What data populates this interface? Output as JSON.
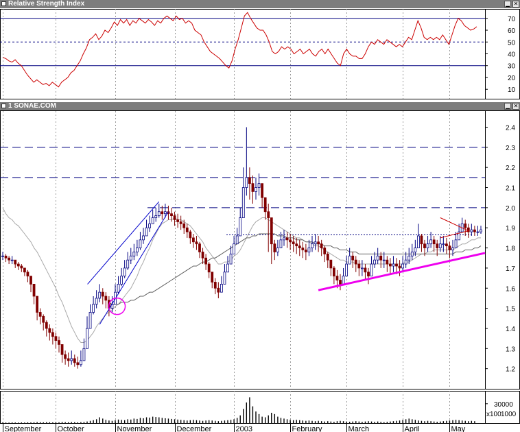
{
  "panels": {
    "rsi_title": "Relative Strength Index",
    "price_title": "1 SONAE.COM"
  },
  "colors": {
    "up": "#ffffff",
    "down": "#800000",
    "upline": "#000080",
    "rsi": "#cc0000",
    "trend_blue": "#0000cc",
    "support": "#ee00ee",
    "pennant": "#cc0000",
    "ma_fast": "#a8a8a8",
    "ma_slow": "#606060"
  },
  "chart_data": [
    {
      "type": "line",
      "title": "Relative Strength Index",
      "ylim": [
        2,
        78
      ],
      "y_ticks": [
        "10",
        "20",
        "30",
        "40",
        "50",
        "60",
        "70"
      ],
      "reference_lines": [
        30,
        50,
        70
      ],
      "series": [
        {
          "values": [
            37,
            36,
            34,
            33,
            35,
            32,
            30,
            26,
            22,
            19,
            16,
            18,
            16,
            14,
            15,
            13,
            16,
            14,
            12,
            16,
            18,
            20,
            24,
            26,
            30,
            34,
            40,
            45,
            52,
            54,
            57,
            52,
            55,
            60,
            58,
            62,
            67,
            64,
            69,
            66,
            69,
            64,
            68,
            66,
            70,
            68,
            66,
            69,
            67,
            64,
            68,
            66,
            70,
            72,
            70,
            68,
            72,
            69,
            70,
            66,
            68,
            66,
            60,
            58,
            56,
            50,
            46,
            42,
            40,
            38,
            36,
            33,
            30,
            28,
            34,
            44,
            52,
            62,
            72,
            75,
            70,
            66,
            62,
            60,
            60,
            56,
            50,
            42,
            40,
            42,
            46,
            44,
            46,
            44,
            40,
            42,
            44,
            40,
            42,
            44,
            40,
            38,
            42,
            44,
            40,
            44,
            40,
            36,
            32,
            30,
            40,
            44,
            40,
            38,
            38,
            36,
            36,
            40,
            46,
            50,
            48,
            52,
            50,
            48,
            52,
            50,
            48,
            46,
            48,
            46,
            50,
            54,
            52,
            60,
            68,
            62,
            54,
            52,
            54,
            52,
            54,
            52,
            56,
            52,
            48,
            56,
            64,
            70,
            68,
            64,
            62,
            60,
            61,
            63
          ]
        }
      ]
    },
    {
      "type": "candlestick",
      "title": "1 SONAE.COM",
      "ylim": [
        1.1,
        2.48
      ],
      "y_ticks": [
        "1.2",
        "1.3",
        "1.4",
        "1.5",
        "1.6",
        "1.7",
        "1.8",
        "1.9",
        "2.0",
        "2.1",
        "2.2",
        "2.3",
        "2.4"
      ],
      "x_labels": [
        "September",
        "October",
        "November",
        "December",
        "2003",
        "February",
        "March",
        "April",
        "May"
      ],
      "resistance_levels": [
        2.3,
        2.15,
        2.0,
        1.865
      ],
      "close": [
        1.76,
        1.75,
        1.74,
        1.74,
        1.72,
        1.71,
        1.7,
        1.68,
        1.66,
        1.62,
        1.56,
        1.48,
        1.46,
        1.43,
        1.4,
        1.38,
        1.36,
        1.34,
        1.32,
        1.27,
        1.25,
        1.24,
        1.25,
        1.23,
        1.22,
        1.24,
        1.3,
        1.4,
        1.48,
        1.52,
        1.55,
        1.58,
        1.56,
        1.54,
        1.5,
        1.52,
        1.58,
        1.62,
        1.66,
        1.7,
        1.74,
        1.76,
        1.78,
        1.8,
        1.84,
        1.86,
        1.9,
        1.92,
        1.95,
        1.96,
        1.98,
        1.97,
        1.98,
        1.97,
        1.96,
        1.94,
        1.93,
        1.92,
        1.9,
        1.88,
        1.85,
        1.83,
        1.82,
        1.78,
        1.75,
        1.72,
        1.68,
        1.63,
        1.6,
        1.58,
        1.62,
        1.68,
        1.72,
        1.77,
        1.82,
        1.86,
        1.95,
        2.1,
        2.15,
        2.12,
        2.08,
        2.1,
        2.12,
        2.05,
        1.98,
        1.95,
        1.82,
        1.78,
        1.8,
        1.84,
        1.85,
        1.84,
        1.83,
        1.82,
        1.81,
        1.8,
        1.79,
        1.78,
        1.8,
        1.82,
        1.83,
        1.82,
        1.8,
        1.77,
        1.74,
        1.7,
        1.66,
        1.64,
        1.62,
        1.66,
        1.72,
        1.76,
        1.74,
        1.72,
        1.7,
        1.7,
        1.68,
        1.66,
        1.72,
        1.74,
        1.76,
        1.74,
        1.74,
        1.72,
        1.71,
        1.72,
        1.71,
        1.7,
        1.72,
        1.74,
        1.76,
        1.78,
        1.8,
        1.86,
        1.82,
        1.8,
        1.82,
        1.84,
        1.82,
        1.8,
        1.82,
        1.82,
        1.81,
        1.79,
        1.8,
        1.84,
        1.88,
        1.92,
        1.9,
        1.88,
        1.89,
        1.88,
        1.88,
        1.89
      ],
      "high": [
        1.78,
        1.77,
        1.76,
        1.76,
        1.74,
        1.73,
        1.72,
        1.7,
        1.69,
        1.66,
        1.61,
        1.54,
        1.5,
        1.47,
        1.44,
        1.42,
        1.4,
        1.38,
        1.36,
        1.32,
        1.29,
        1.28,
        1.29,
        1.27,
        1.26,
        1.29,
        1.35,
        1.46,
        1.52,
        1.56,
        1.59,
        1.62,
        1.6,
        1.58,
        1.56,
        1.56,
        1.62,
        1.66,
        1.7,
        1.74,
        1.78,
        1.8,
        1.82,
        1.84,
        1.88,
        1.9,
        1.94,
        1.96,
        1.99,
        2.0,
        2.02,
        2.01,
        2.02,
        2.01,
        2.0,
        1.98,
        1.97,
        1.96,
        1.94,
        1.92,
        1.89,
        1.87,
        1.86,
        1.83,
        1.8,
        1.77,
        1.73,
        1.68,
        1.65,
        1.63,
        1.66,
        1.72,
        1.76,
        1.81,
        1.86,
        1.9,
        2.0,
        2.2,
        2.4,
        2.2,
        2.16,
        2.15,
        2.17,
        2.12,
        2.04,
        2.02,
        1.9,
        1.84,
        1.84,
        1.88,
        1.89,
        1.88,
        1.87,
        1.86,
        1.85,
        1.84,
        1.83,
        1.82,
        1.84,
        1.86,
        1.87,
        1.86,
        1.84,
        1.81,
        1.78,
        1.74,
        1.71,
        1.69,
        1.67,
        1.7,
        1.76,
        1.8,
        1.78,
        1.76,
        1.74,
        1.74,
        1.72,
        1.7,
        1.76,
        1.78,
        1.8,
        1.78,
        1.78,
        1.76,
        1.75,
        1.76,
        1.75,
        1.74,
        1.76,
        1.78,
        1.8,
        1.82,
        1.84,
        1.92,
        1.87,
        1.84,
        1.86,
        1.88,
        1.86,
        1.84,
        1.86,
        1.86,
        1.85,
        1.83,
        1.84,
        1.88,
        1.92,
        1.95,
        1.94,
        1.92,
        1.92,
        1.91,
        1.91,
        1.91
      ],
      "low": [
        1.74,
        1.73,
        1.72,
        1.72,
        1.7,
        1.69,
        1.68,
        1.66,
        1.63,
        1.58,
        1.52,
        1.44,
        1.42,
        1.39,
        1.36,
        1.34,
        1.32,
        1.3,
        1.28,
        1.23,
        1.22,
        1.21,
        1.22,
        1.21,
        1.2,
        1.21,
        1.24,
        1.3,
        1.42,
        1.47,
        1.5,
        1.53,
        1.52,
        1.5,
        1.46,
        1.48,
        1.52,
        1.57,
        1.61,
        1.65,
        1.69,
        1.72,
        1.74,
        1.76,
        1.79,
        1.82,
        1.86,
        1.88,
        1.92,
        1.93,
        1.95,
        1.94,
        1.95,
        1.94,
        1.93,
        1.91,
        1.9,
        1.89,
        1.87,
        1.85,
        1.82,
        1.8,
        1.79,
        1.75,
        1.72,
        1.69,
        1.65,
        1.6,
        1.57,
        1.55,
        1.58,
        1.64,
        1.68,
        1.73,
        1.77,
        1.82,
        1.86,
        1.97,
        2.06,
        2.04,
        2.02,
        2.04,
        2.06,
        2.0,
        1.94,
        1.78,
        1.72,
        1.74,
        1.76,
        1.8,
        1.81,
        1.8,
        1.79,
        1.78,
        1.77,
        1.76,
        1.75,
        1.74,
        1.76,
        1.78,
        1.79,
        1.78,
        1.76,
        1.73,
        1.7,
        1.66,
        1.62,
        1.6,
        1.59,
        1.62,
        1.66,
        1.72,
        1.7,
        1.68,
        1.66,
        1.66,
        1.64,
        1.62,
        1.68,
        1.7,
        1.72,
        1.7,
        1.7,
        1.68,
        1.67,
        1.68,
        1.67,
        1.66,
        1.68,
        1.7,
        1.72,
        1.74,
        1.76,
        1.82,
        1.78,
        1.76,
        1.78,
        1.8,
        1.78,
        1.76,
        1.78,
        1.78,
        1.77,
        1.75,
        1.76,
        1.8,
        1.84,
        1.88,
        1.86,
        1.85,
        1.86,
        1.86,
        1.86,
        1.87
      ],
      "ma_fast": [
        2.0,
        1.97,
        1.95,
        1.94,
        1.92,
        1.91,
        1.89,
        1.87,
        1.85,
        1.83,
        1.8,
        1.78,
        1.75,
        1.72,
        1.69,
        1.66,
        1.63,
        1.6,
        1.56,
        1.53,
        1.49,
        1.45,
        1.41,
        1.38,
        1.35,
        1.33,
        1.33,
        1.34,
        1.36,
        1.38,
        1.41,
        1.43,
        1.45,
        1.47,
        1.48,
        1.49,
        1.51,
        1.52,
        1.54,
        1.56,
        1.58,
        1.6,
        1.63,
        1.66,
        1.7,
        1.73,
        1.77,
        1.8,
        1.84,
        1.87,
        1.9,
        1.92,
        1.93,
        1.94,
        1.94,
        1.95,
        1.94,
        1.94,
        1.93,
        1.92,
        1.91,
        1.89,
        1.87,
        1.85,
        1.83,
        1.8,
        1.78,
        1.76,
        1.74,
        1.72,
        1.72,
        1.73,
        1.73,
        1.74,
        1.76,
        1.77,
        1.79,
        1.82,
        1.85,
        1.88,
        1.91,
        1.93,
        1.94,
        1.95,
        1.95,
        1.94,
        1.93,
        1.92,
        1.91,
        1.9,
        1.89,
        1.88,
        1.87,
        1.86,
        1.85,
        1.85,
        1.84,
        1.83,
        1.83,
        1.82,
        1.81,
        1.81,
        1.8,
        1.79,
        1.78,
        1.77,
        1.76,
        1.75,
        1.74,
        1.74,
        1.73,
        1.73,
        1.73,
        1.72,
        1.72,
        1.72,
        1.72,
        1.72,
        1.72,
        1.72,
        1.72,
        1.72,
        1.72,
        1.72,
        1.72,
        1.72,
        1.72,
        1.72,
        1.72,
        1.73,
        1.73,
        1.74,
        1.75,
        1.76,
        1.77,
        1.77,
        1.78,
        1.78,
        1.79,
        1.79,
        1.79,
        1.79,
        1.79,
        1.79,
        1.79,
        1.8,
        1.81,
        1.82,
        1.82,
        1.83,
        1.84,
        1.84,
        1.85,
        1.85
      ],
      "ma_slow": [
        null,
        null,
        null,
        null,
        null,
        null,
        null,
        null,
        null,
        null,
        null,
        null,
        null,
        null,
        null,
        null,
        null,
        null,
        null,
        null,
        null,
        null,
        null,
        null,
        null,
        null,
        null,
        null,
        null,
        null,
        null,
        null,
        null,
        null,
        1.53,
        1.52,
        1.52,
        1.52,
        1.53,
        1.53,
        1.53,
        1.54,
        1.54,
        1.55,
        1.56,
        1.56,
        1.57,
        1.58,
        1.58,
        1.59,
        1.6,
        1.61,
        1.62,
        1.63,
        1.64,
        1.65,
        1.66,
        1.67,
        1.68,
        1.69,
        1.7,
        1.71,
        1.71,
        1.72,
        1.73,
        1.73,
        1.74,
        1.75,
        1.75,
        1.76,
        1.77,
        1.78,
        1.79,
        1.8,
        1.81,
        1.82,
        1.83,
        1.84,
        1.85,
        1.85,
        1.86,
        1.86,
        1.87,
        1.87,
        1.87,
        1.87,
        1.87,
        1.87,
        1.86,
        1.86,
        1.86,
        1.85,
        1.85,
        1.85,
        1.84,
        1.84,
        1.84,
        1.83,
        1.83,
        1.83,
        1.82,
        1.82,
        1.82,
        1.81,
        1.81,
        1.81,
        1.8,
        1.8,
        1.79,
        1.79,
        1.79,
        1.78,
        1.78,
        1.78,
        1.77,
        1.77,
        1.77,
        1.77,
        1.77,
        1.77,
        1.77,
        1.77,
        1.77,
        1.77,
        1.77,
        1.77,
        1.77,
        1.77,
        1.77,
        1.77,
        1.77,
        1.77,
        1.77,
        1.77,
        1.77,
        1.77,
        1.77,
        1.77,
        1.77,
        1.77,
        1.77,
        1.77,
        1.77,
        1.77,
        1.77,
        1.78,
        1.78,
        1.78,
        1.79,
        1.79,
        1.79,
        1.8,
        1.8,
        1.81
      ]
    },
    {
      "type": "bar",
      "title": "",
      "ylim": [
        0,
        50000
      ],
      "y_ticks": [
        "30000",
        "x100",
        "1000"
      ],
      "values": [
        1000,
        900,
        800,
        1100,
        900,
        800,
        1000,
        900,
        1200,
        1100,
        1300,
        1600,
        1400,
        1200,
        1500,
        1300,
        1100,
        1400,
        1200,
        1800,
        1500,
        1300,
        1600,
        1400,
        1200,
        1500,
        1800,
        2500,
        3500,
        4500,
        6000,
        9000,
        7000,
        5000,
        4000,
        3500,
        4500,
        5500,
        5000,
        4500,
        6000,
        5500,
        7000,
        6500,
        8000,
        7500,
        9000,
        8500,
        10000,
        9500,
        9000,
        8000,
        7500,
        7000,
        6500,
        6000,
        5500,
        5000,
        4500,
        4000,
        4500,
        5000,
        4500,
        4000,
        3500,
        4000,
        4500,
        4000,
        3500,
        3000,
        3500,
        4000,
        4500,
        5000,
        6000,
        8000,
        12000,
        22000,
        32000,
        40000,
        26000,
        18000,
        14000,
        10000,
        9000,
        12000,
        16000,
        14000,
        10000,
        8000,
        7000,
        6000,
        5000,
        4500,
        5000,
        4500,
        4000,
        3500,
        4000,
        3500,
        3000,
        3500,
        3000,
        2500,
        3000,
        2500,
        2000,
        3000,
        3500,
        3000,
        2500,
        2000,
        2500,
        3000,
        2500,
        2000,
        2500,
        3000,
        2500,
        2000,
        2500,
        2000,
        1500,
        2000,
        2500,
        3000,
        3500,
        4000,
        5000,
        6000,
        7000,
        6000,
        5000,
        4000,
        3500,
        3000,
        3500,
        3000,
        2500,
        2000,
        2500,
        3000,
        3500,
        4000,
        4500,
        5000,
        4500,
        4000,
        3500,
        3000,
        3500,
        3000
      ]
    }
  ]
}
